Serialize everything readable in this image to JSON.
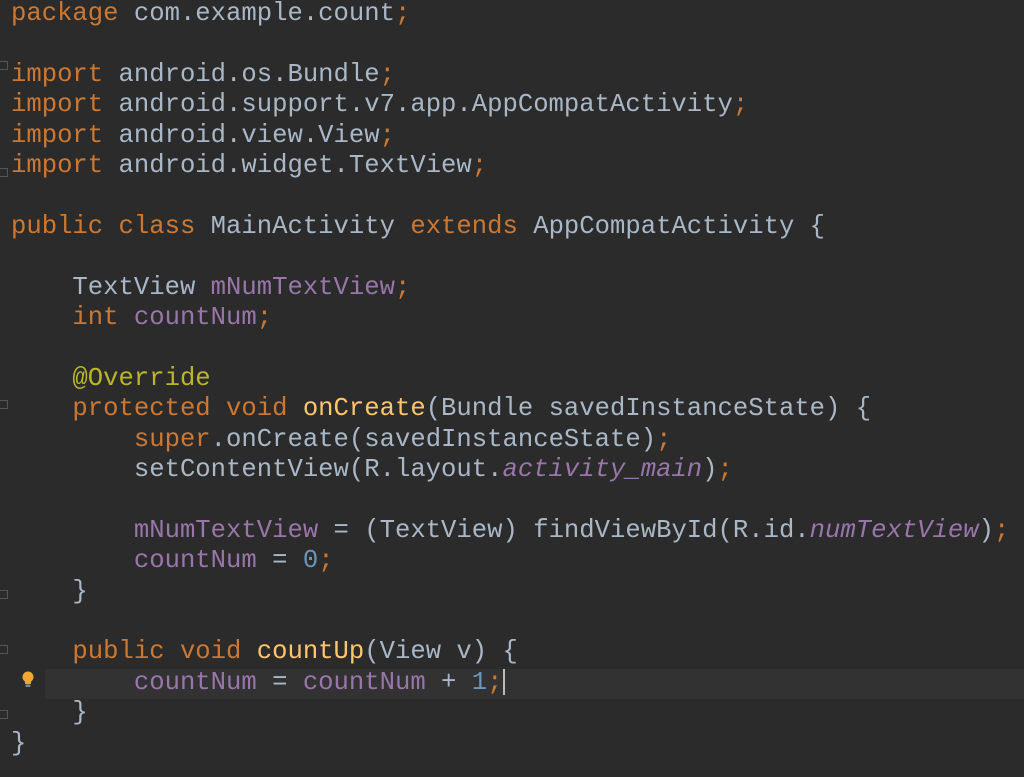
{
  "editor": {
    "theme_colors": {
      "background": "#2b2b2b",
      "keyword": "#cc7832",
      "text": "#a9b7c6",
      "field": "#9876aa",
      "number": "#6897bb",
      "method": "#ffc66d",
      "annotation": "#bbb529",
      "current_line": "#323232"
    },
    "current_line": 23,
    "gutter_icon": "lightbulb-icon",
    "lines": [
      [
        [
          "package",
          "kw"
        ],
        [
          " com.example.count",
          "tx"
        ],
        [
          ";",
          "kw"
        ]
      ],
      [],
      [
        [
          "import",
          "kw"
        ],
        [
          " android.os.Bundle",
          "tx"
        ],
        [
          ";",
          "kw"
        ]
      ],
      [
        [
          "import",
          "kw"
        ],
        [
          " android.support.v7.app.AppCompatActivity",
          "tx"
        ],
        [
          ";",
          "kw"
        ]
      ],
      [
        [
          "import",
          "kw"
        ],
        [
          " android.view.View",
          "tx"
        ],
        [
          ";",
          "kw"
        ]
      ],
      [
        [
          "import",
          "kw"
        ],
        [
          " android.widget.TextView",
          "tx"
        ],
        [
          ";",
          "kw"
        ]
      ],
      [],
      [
        [
          "public class",
          "kw"
        ],
        [
          " MainActivity ",
          "tx"
        ],
        [
          "extends",
          "kw"
        ],
        [
          " AppCompatActivity {",
          "tx"
        ]
      ],
      [],
      [
        [
          "    TextView ",
          "tx"
        ],
        [
          "mNumTextView",
          "fd"
        ],
        [
          ";",
          "kw"
        ]
      ],
      [
        [
          "    int",
          "kw"
        ],
        [
          " ",
          "tx"
        ],
        [
          "countNum",
          "fd"
        ],
        [
          ";",
          "kw"
        ]
      ],
      [],
      [
        [
          "    @Override",
          "an"
        ]
      ],
      [
        [
          "    protected void",
          "kw"
        ],
        [
          " ",
          "tx"
        ],
        [
          "onCreate",
          "md"
        ],
        [
          "(Bundle savedInstanceState) {",
          "tx"
        ]
      ],
      [
        [
          "        super",
          "kw"
        ],
        [
          ".onCreate(savedInstanceState)",
          "tx"
        ],
        [
          ";",
          "kw"
        ]
      ],
      [
        [
          "        setContentView(R.layout.",
          "tx"
        ],
        [
          "activity_main",
          "fi"
        ],
        [
          ")",
          "tx"
        ],
        [
          ";",
          "kw"
        ]
      ],
      [],
      [
        [
          "        mNumTextView",
          "fd"
        ],
        [
          " = (TextView) findViewById(R.id.",
          "tx"
        ],
        [
          "numTextView",
          "fi"
        ],
        [
          ")",
          "tx"
        ],
        [
          ";",
          "kw"
        ]
      ],
      [
        [
          "        countNum",
          "fd"
        ],
        [
          " = ",
          "tx"
        ],
        [
          "0",
          "nm"
        ],
        [
          ";",
          "kw"
        ]
      ],
      [
        [
          "    }",
          "tx"
        ]
      ],
      [],
      [
        [
          "    public void",
          "kw"
        ],
        [
          " ",
          "tx"
        ],
        [
          "countUp",
          "md"
        ],
        [
          "(View v) {",
          "tx"
        ]
      ],
      [
        [
          "        countNum",
          "fd"
        ],
        [
          " = ",
          "tx"
        ],
        [
          "countNum",
          "fd"
        ],
        [
          " + ",
          "tx"
        ],
        [
          "1",
          "nm"
        ],
        [
          ";",
          "kw"
        ]
      ],
      [
        [
          "    }",
          "tx"
        ]
      ],
      [
        [
          "}",
          "tx"
        ]
      ]
    ]
  }
}
